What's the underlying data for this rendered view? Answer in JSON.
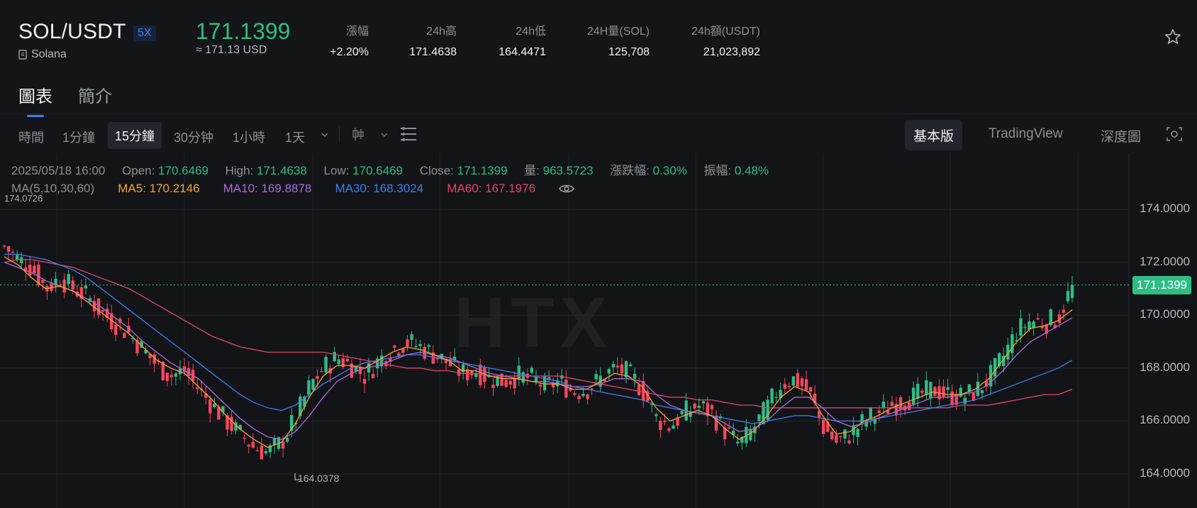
{
  "header": {
    "pair": "SOL/USDT",
    "leverage": "5X",
    "coin_name": "Solana",
    "price": "171.1399",
    "price_usd": "≈ 171.13 USD",
    "stats": [
      {
        "label": "漲幅",
        "value": "+2.20%"
      },
      {
        "label": "24h高",
        "value": "171.4638"
      },
      {
        "label": "24h低",
        "value": "164.4471"
      },
      {
        "label": "24H量(SOL)",
        "value": "125,708"
      },
      {
        "label": "24h額(USDT)",
        "value": "21,023,892"
      }
    ]
  },
  "tabs": [
    "圖表",
    "簡介"
  ],
  "toolbar": {
    "intervals": [
      "時間",
      "1分鐘",
      "15分鐘",
      "30分钟",
      "1小時",
      "1天"
    ],
    "active_interval": "15分鐘",
    "views": [
      "基本版",
      "TradingView",
      "深度圖"
    ],
    "active_view": "基本版"
  },
  "info": {
    "time": "2025/05/18 16:00",
    "open_label": "Open:",
    "open": "170.6469",
    "high_label": "High:",
    "high": "171.4638",
    "low_label": "Low:",
    "low": "170.6469",
    "close_label": "Close:",
    "close": "171.1399",
    "vol_label": "量:",
    "vol": "963.5723",
    "chg_label": "漲跌幅:",
    "chg": "0.30%",
    "amp_label": "振幅:",
    "amp": "0.48%"
  },
  "ma": {
    "label": "MA(5,10,30,60)",
    "ma5": "MA5: 170.2146",
    "ma10": "MA10: 169.8878",
    "ma30": "MA30: 168.3024",
    "ma60": "MA60: 167.1976"
  },
  "chart_data": {
    "type": "candlestick",
    "y_ticks": [
      "174.0000",
      "172.0000",
      "170.0000",
      "168.0000",
      "166.0000",
      "164.0000"
    ],
    "ylim": [
      163.2,
      175.8
    ],
    "current_price_label": "171.1399",
    "high_marker": "174.0726",
    "low_marker": "164.0378",
    "watermark": "HTX",
    "colors": {
      "up": "#2ebd85",
      "down": "#f6465d",
      "ma5": "#f0a33a",
      "ma10": "#a86ad8",
      "ma30": "#3d7eef",
      "ma60": "#e0456f"
    },
    "close_path": [
      172.6,
      172.1,
      171.8,
      171.0,
      171.4,
      171.0,
      170.7,
      170.1,
      169.7,
      169.3,
      168.7,
      168.1,
      167.7,
      167.9,
      167.2,
      166.6,
      166.0,
      165.5,
      165.0,
      164.8,
      165.2,
      166.1,
      167.3,
      168.0,
      168.4,
      168.1,
      167.7,
      168.3,
      168.7,
      169.0,
      168.8,
      168.5,
      168.2,
      167.8,
      167.9,
      167.6,
      167.5,
      167.7,
      167.6,
      167.3,
      167.5,
      167.1,
      167.2,
      167.6,
      168.0,
      167.8,
      167.2,
      166.1,
      165.8,
      166.3,
      166.6,
      166.3,
      165.6,
      165.1,
      165.7,
      166.5,
      167.4,
      167.6,
      167.1,
      165.8,
      165.2,
      165.5,
      166.0,
      166.3,
      166.6,
      166.8,
      167.0,
      167.2,
      167.0,
      166.9,
      167.1,
      167.6,
      168.4,
      169.4,
      169.8,
      169.7,
      169.9,
      171.1
    ],
    "ma5_path": [
      172.2,
      171.9,
      171.4,
      171.0,
      171.1,
      170.9,
      170.5,
      170.1,
      169.7,
      169.3,
      168.8,
      168.3,
      168.0,
      167.8,
      167.3,
      166.8,
      166.2,
      165.7,
      165.3,
      165.0,
      165.2,
      165.9,
      166.9,
      167.7,
      168.1,
      168.1,
      168.0,
      168.3,
      168.6,
      168.8,
      168.7,
      168.5,
      168.3,
      167.9,
      167.9,
      167.7,
      167.6,
      167.6,
      167.5,
      167.4,
      167.4,
      167.2,
      167.2,
      167.5,
      167.8,
      167.7,
      167.3,
      166.5,
      166.0,
      166.2,
      166.4,
      166.2,
      165.7,
      165.3,
      165.6,
      166.2,
      166.9,
      167.3,
      167.1,
      166.2,
      165.5,
      165.6,
      166.0,
      166.2,
      166.5,
      166.7,
      166.9,
      167.1,
      167.0,
      167.0,
      167.2,
      167.6,
      168.3,
      169.0,
      169.5,
      169.6,
      169.8,
      170.2
    ],
    "ma10_path": [
      172.0,
      171.8,
      171.6,
      171.3,
      171.1,
      170.9,
      170.6,
      170.3,
      169.9,
      169.5,
      169.0,
      168.6,
      168.2,
      167.9,
      167.6,
      167.1,
      166.6,
      166.1,
      165.7,
      165.4,
      165.3,
      165.6,
      166.2,
      166.9,
      167.5,
      167.8,
      168.0,
      168.1,
      168.3,
      168.5,
      168.6,
      168.5,
      168.4,
      168.2,
      168.0,
      167.8,
      167.7,
      167.6,
      167.5,
      167.5,
      167.4,
      167.3,
      167.3,
      167.4,
      167.6,
      167.6,
      167.5,
      167.0,
      166.6,
      166.4,
      166.3,
      166.2,
      165.9,
      165.6,
      165.7,
      166.0,
      166.5,
      166.9,
      166.9,
      166.5,
      166.0,
      165.8,
      165.9,
      166.1,
      166.3,
      166.5,
      166.7,
      166.9,
      166.9,
      167.0,
      167.1,
      167.4,
      167.9,
      168.5,
      169.0,
      169.3,
      169.6,
      169.9
    ],
    "ma30_path": [
      172.3,
      172.3,
      172.2,
      172.1,
      171.9,
      171.7,
      171.4,
      171.0,
      170.6,
      170.2,
      169.8,
      169.4,
      169.0,
      168.6,
      168.2,
      167.8,
      167.4,
      167.0,
      166.7,
      166.5,
      166.4,
      166.6,
      167.0,
      167.4,
      167.7,
      168.0,
      168.2,
      168.3,
      168.4,
      168.5,
      168.5,
      168.4,
      168.3,
      168.2,
      168.1,
      168.0,
      167.9,
      167.8,
      167.7,
      167.6,
      167.5,
      167.3,
      167.2,
      167.1,
      167.0,
      166.9,
      166.8,
      166.6,
      166.5,
      166.4,
      166.3,
      166.2,
      166.1,
      166.0,
      165.9,
      166.0,
      166.1,
      166.2,
      166.2,
      166.1,
      166.0,
      166.0,
      166.0,
      166.1,
      166.2,
      166.3,
      166.4,
      166.5,
      166.6,
      166.7,
      166.8,
      167.0,
      167.2,
      167.4,
      167.6,
      167.8,
      168.0,
      168.3
    ],
    "ma60_path": [
      172.0,
      172.1,
      172.1,
      172.0,
      171.9,
      171.8,
      171.6,
      171.4,
      171.2,
      171.0,
      170.7,
      170.4,
      170.1,
      169.8,
      169.5,
      169.2,
      169.0,
      168.8,
      168.7,
      168.6,
      168.6,
      168.6,
      168.6,
      168.6,
      168.5,
      168.4,
      168.3,
      168.2,
      168.1,
      168.0,
      168.0,
      167.9,
      167.9,
      167.8,
      167.8,
      167.7,
      167.7,
      167.7,
      167.7,
      167.7,
      167.7,
      167.6,
      167.5,
      167.4,
      167.3,
      167.2,
      167.1,
      167.0,
      166.9,
      166.9,
      166.8,
      166.8,
      166.7,
      166.6,
      166.6,
      166.5,
      166.5,
      166.5,
      166.5,
      166.5,
      166.5,
      166.5,
      166.5,
      166.5,
      166.5,
      166.5,
      166.5,
      166.5,
      166.5,
      166.6,
      166.6,
      166.6,
      166.7,
      166.8,
      166.9,
      167.0,
      167.0,
      167.2
    ]
  }
}
